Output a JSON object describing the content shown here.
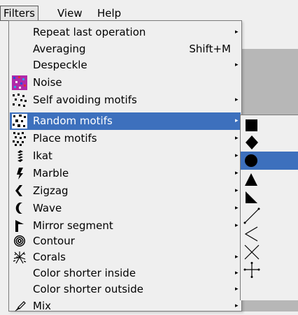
{
  "menubar": {
    "filters": "Filters",
    "view": "View",
    "help": "Help"
  },
  "filters_menu": {
    "repeat": "Repeat last operation",
    "averaging": "Averaging",
    "averaging_shortcut": "Shift+M",
    "despeckle": "Despeckle",
    "noise": "Noise",
    "self_avoiding": "Self avoiding motifs",
    "random_motifs": "Random motifs",
    "place_motifs": "Place motifs",
    "ikat": "Ikat",
    "marble": "Marble",
    "zigzag": "Zigzag",
    "wave": "Wave",
    "mirror_segment": "Mirror segment",
    "contour": "Contour",
    "corals": "Corals",
    "color_shorter_inside": "Color shorter inside",
    "color_shorter_outside": "Color shorter outside",
    "mix": "Mix",
    "submenu_arrow": "▸"
  },
  "motif_submenu": [
    "square-motif",
    "diamond-motif",
    "circle-motif",
    "triangle-motif",
    "right-triangle-motif",
    "diagonal-line-motif",
    "chevron-motif",
    "x-cross-motif",
    "plus-cross-motif"
  ],
  "colors": {
    "highlight": "#3d70bd",
    "menu_bg": "#efefef",
    "canvas": "#b7b7b7"
  }
}
